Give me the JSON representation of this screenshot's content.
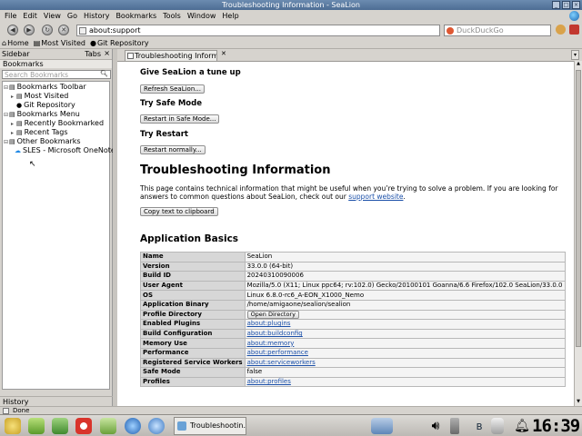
{
  "window": {
    "title": "Troubleshooting Information - SeaLion"
  },
  "menu": [
    "File",
    "Edit",
    "View",
    "Go",
    "History",
    "Bookmarks",
    "Tools",
    "Window",
    "Help"
  ],
  "nav": {
    "url": "about:support",
    "search_placeholder": "DuckDuckGo"
  },
  "bookmarks_bar": [
    {
      "icon": "home-icon",
      "label": "Home"
    },
    {
      "icon": "bookmarks-folder-icon",
      "label": "Most Visited"
    },
    {
      "icon": "github-icon",
      "label": "Git Repository"
    }
  ],
  "sidebar": {
    "title": "Sidebar",
    "tabs_label": "Tabs",
    "section": "Bookmarks",
    "search_placeholder": "Search Bookmarks",
    "tree": [
      {
        "label": "Bookmarks Toolbar",
        "icon": "folder-icon",
        "level": 0,
        "expanded": true
      },
      {
        "label": "Most Visited",
        "icon": "folder-icon",
        "level": 1,
        "expanded": false
      },
      {
        "label": "Git Repository",
        "icon": "github-icon",
        "level": 1
      },
      {
        "label": "Bookmarks Menu",
        "icon": "folder-icon",
        "level": 0,
        "expanded": true
      },
      {
        "label": "Recently Bookmarked",
        "icon": "folder-icon",
        "level": 1,
        "expanded": false
      },
      {
        "label": "Recent Tags",
        "icon": "folder-icon",
        "level": 1,
        "expanded": false
      },
      {
        "label": "Other Bookmarks",
        "icon": "folder-icon",
        "level": 0,
        "expanded": true
      },
      {
        "label": "SLES - Microsoft OneNote ...",
        "icon": "cloud-icon",
        "level": 1
      }
    ],
    "footer": "History"
  },
  "tab": {
    "label": "Troubleshooting Information"
  },
  "page": {
    "tuneup_title": "Give SeaLion a tune up",
    "refresh_button": "Refresh SeaLion...",
    "safe_mode_title": "Try Safe Mode",
    "safe_mode_button": "Restart in Safe Mode...",
    "restart_title": "Try Restart",
    "restart_button": "Restart normally...",
    "main_title": "Troubleshooting Information",
    "intro": "This page contains technical information that might be useful when you’re trying to solve a problem. If you are looking for answers to common questions about SeaLion, check out our ",
    "support_link": "support website",
    "intro_end": ".",
    "copy_button": "Copy text to clipboard",
    "basics_title": "Application Basics",
    "basics": [
      {
        "key": "Name",
        "value": "SeaLion"
      },
      {
        "key": "Version",
        "value": "33.0.0 (64-bit)"
      },
      {
        "key": "Build ID",
        "value": "20240310090006"
      },
      {
        "key": "User Agent",
        "value": "Mozilla/5.0 (X11; Linux ppc64; rv:102.0) Gecko/20100101 Goanna/6.6 Firefox/102.0 SeaLion/33.0.0"
      },
      {
        "key": "OS",
        "value": "Linux 6.8.0-rc6_A-EON_X1000_Nemo"
      },
      {
        "key": "Application Binary",
        "value": "/home/amigaone/sealion/sealion"
      },
      {
        "key": "Profile Directory",
        "button": "Open Directory"
      },
      {
        "key": "Enabled Plugins",
        "link": "about:plugins"
      },
      {
        "key": "Build Configuration",
        "link": "about:buildconfig"
      },
      {
        "key": "Memory Use",
        "link": "about:memory"
      },
      {
        "key": "Performance",
        "link": "about:performance"
      },
      {
        "key": "Registered Service Workers",
        "link": "about:serviceworkers"
      },
      {
        "key": "Safe Mode",
        "value": "false"
      },
      {
        "key": "Profiles",
        "link": "about:profiles"
      }
    ]
  },
  "status": {
    "text": "Done"
  },
  "taskbar": {
    "task_label": "Troubleshootin...",
    "clock": "16:39"
  }
}
